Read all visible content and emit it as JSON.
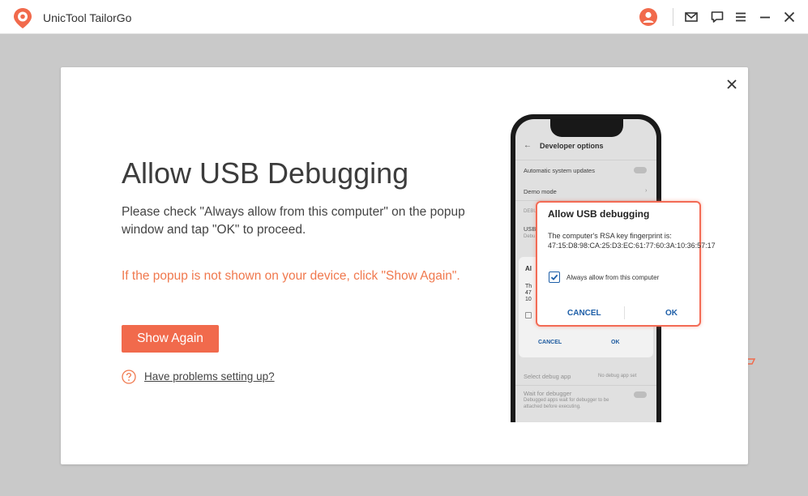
{
  "app": {
    "title": "UnicTool TailorGo",
    "brand_color": "#f16a4c"
  },
  "titlebar": {
    "icons": [
      "account-icon",
      "mail-icon",
      "feedback-icon",
      "menu-icon",
      "minimize-icon",
      "close-icon"
    ]
  },
  "dialog": {
    "title": "Allow USB Debugging",
    "description": "Please check \"Always allow from this computer\" on the popup window and tap \"OK\" to proceed.",
    "warning": "If the popup is not shown on your device, click \"Show Again\".",
    "show_again_label": "Show Again",
    "help_link": "Have problems setting up?",
    "accent_color": "#f0784d"
  },
  "phone": {
    "header": "Developer options",
    "rows": {
      "auto_updates": "Automatic system updates",
      "demo_mode": "Demo mode",
      "debugging_section": "DEBU",
      "usb": "USB",
      "usb_sub": "Debu",
      "select_debug_app": "Select debug app",
      "no_debug_app": "No debug app set",
      "wait_for_debugger": "Wait for debugger",
      "wait_sub_1": "Debugged apps wait for debugger to be",
      "wait_sub_2": "attached before executing."
    },
    "behind_dialog": {
      "line1": "Al",
      "line2": "Th",
      "line3": "47",
      "line4": "10",
      "cancel": "CANCEL",
      "ok": "OK"
    }
  },
  "popup": {
    "title": "Allow USB debugging",
    "body": "The computer's RSA key fingerprint is: 47:15:D8:98:CA:25:D3:EC:61:77:60:3A:10:36:57:17",
    "checkbox_label": "Always allow from this computer",
    "checked": true,
    "cancel_label": "CANCEL",
    "ok_label": "OK"
  }
}
